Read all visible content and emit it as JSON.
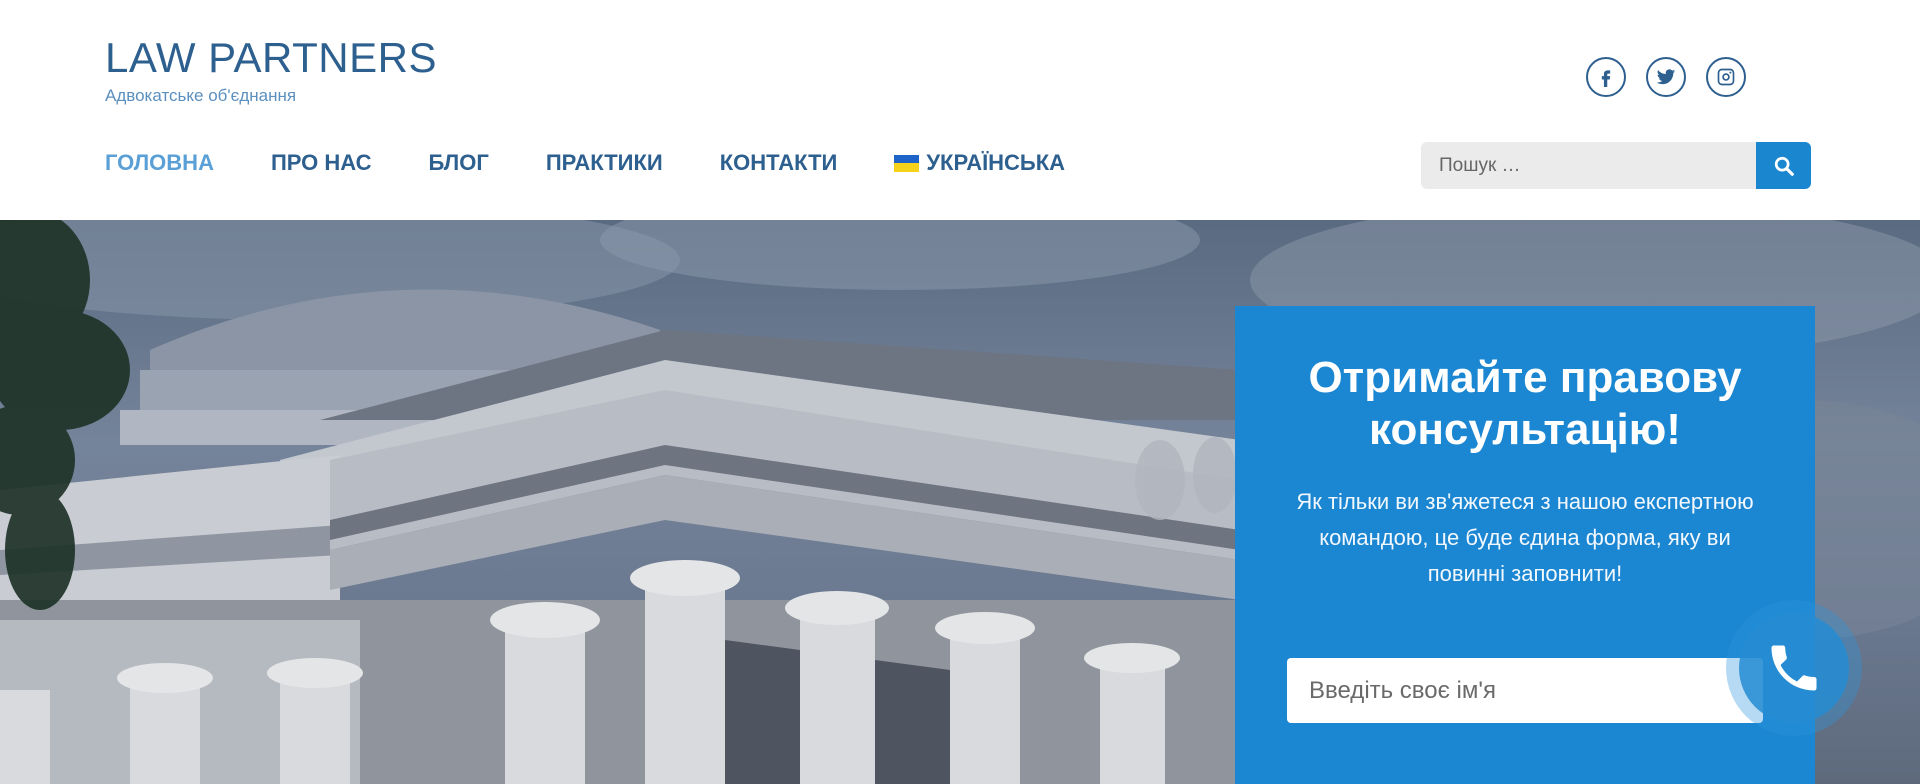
{
  "site": {
    "title": "LAW PARTNERS",
    "tagline": "Адвокатське об'єднання"
  },
  "socials": [
    {
      "icon": "facebook-icon"
    },
    {
      "icon": "twitter-icon"
    },
    {
      "icon": "instagram-icon"
    }
  ],
  "nav": {
    "items": [
      {
        "label": "ГОЛОВНА",
        "active": true
      },
      {
        "label": "ПРО НАС",
        "active": false
      },
      {
        "label": "БЛОГ",
        "active": false
      },
      {
        "label": "ПРАКТИКИ",
        "active": false
      },
      {
        "label": "КОНТАКТИ",
        "active": false
      },
      {
        "label": "УКРАЇНСЬКА",
        "active": false,
        "icon": "ukraine-flag-icon"
      }
    ]
  },
  "search": {
    "placeholder": "Пошук …",
    "icon": "search-icon"
  },
  "form": {
    "title": "Отримайте правову консультацію!",
    "text": "Як тільки ви зв'яжетеся з нашою експертною командою, це буде єдина форма, яку ви повинні заповнити!",
    "name_placeholder": "Введіть своє ім'я"
  },
  "call_button": {
    "icon": "phone-icon"
  },
  "colors": {
    "brand": "#2d5f8f",
    "active_nav": "#5aa0d6",
    "accent": "#1b86d1",
    "search_bg": "#ebebeb"
  }
}
